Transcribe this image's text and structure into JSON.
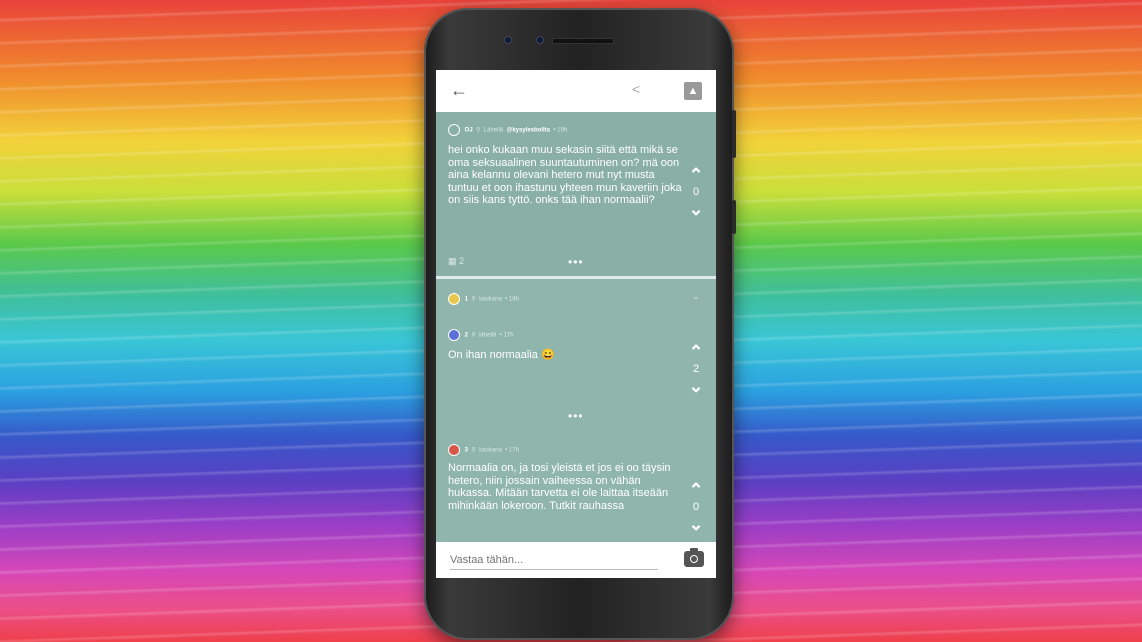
{
  "topbar": {
    "back_icon": "arrow-left-icon",
    "share_icon": "share-icon",
    "pin_icon": "pin-icon"
  },
  "post": {
    "badge_color": "#ffffff",
    "author": "OJ",
    "location": "Lähellä",
    "handle": "@kysylesboilta",
    "time": "• 19h",
    "text": "hei onko kukaan muu sekasin siitä että mikä se oma seksuaalinen suuntautuminen on? mä oon aina kelannu olevani hetero mut nyt musta tuntuu et oon ihastunu yhteen mun kaveriin joka on siis kans tyttö. onks tää ihan normaalii?",
    "votes": "0",
    "comments_count": "2",
    "more": "•••"
  },
  "comments": [
    {
      "num": "1",
      "badge_color": "#e8c84a",
      "location": "kaukana",
      "time": "• 18h",
      "text": "",
      "votes": ""
    },
    {
      "num": "2",
      "badge_color": "#5b6fd6",
      "location": "lähellä",
      "time": "• 17h",
      "text": "On ihan normaalia 😄",
      "votes": "2",
      "more": "•••"
    },
    {
      "num": "3",
      "badge_color": "#d9574a",
      "location": "kaukana",
      "time": "• 17h",
      "text": "Normaalia on, ja tosi yleistä et jos ei oo täysin hetero, niin jossain vaiheessa on vähän hukassa. Mitään tarvetta ei ole laittaa itseään mihinkään lokeroon. Tutkit rauhassa",
      "votes": "0"
    }
  ],
  "reply": {
    "placeholder": "Vastaa tähän...",
    "camera_icon": "camera-icon"
  }
}
